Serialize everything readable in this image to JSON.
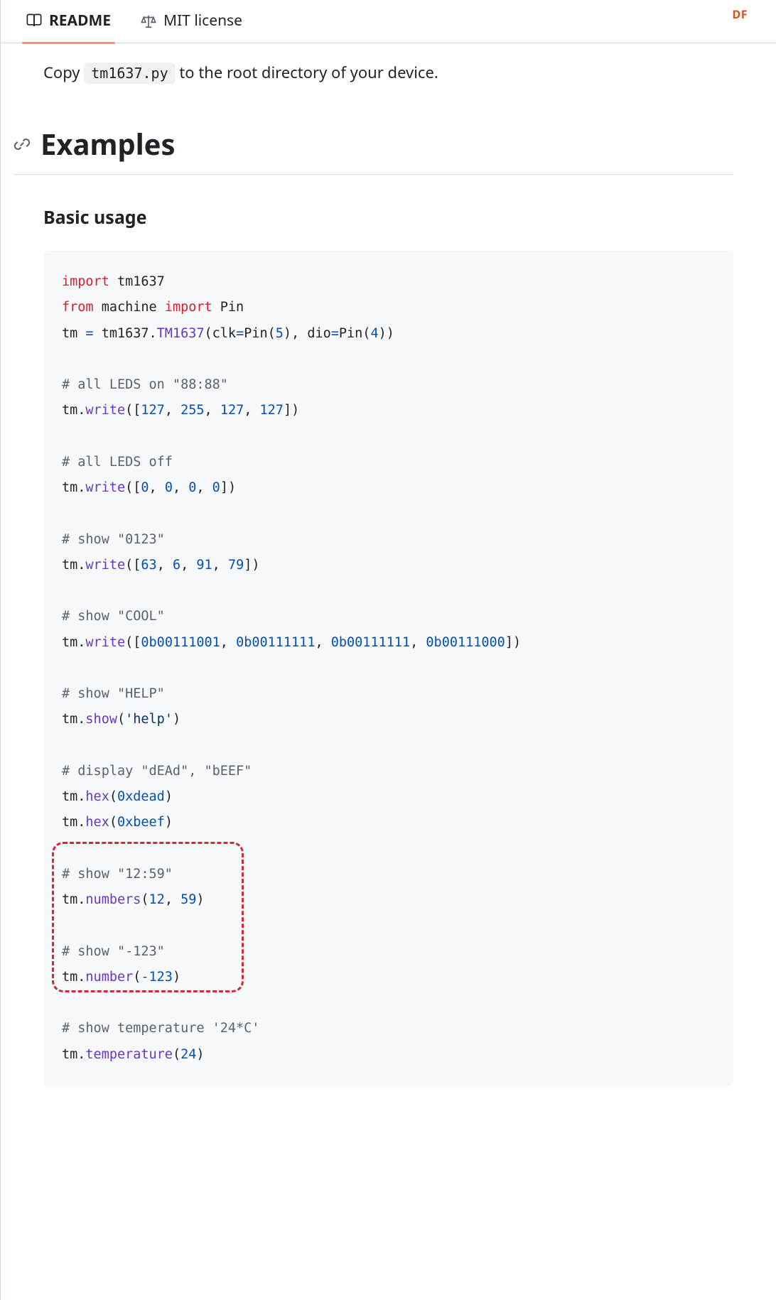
{
  "header": {
    "badge": "DF",
    "tabs": {
      "readme": "README",
      "license": "MIT license"
    }
  },
  "intro": {
    "prefix": "Copy ",
    "code": "tm1637.py",
    "suffix": " to the root directory of your device."
  },
  "headings": {
    "examples": "Examples",
    "basic_usage": "Basic usage"
  },
  "code": {
    "l01_kw1": "import",
    "l01_mod": " tm1637",
    "l02_kw1": "from",
    "l02_mod": " machine ",
    "l02_kw2": "import",
    "l02_cls": " Pin",
    "l03_a": "tm ",
    "l03_eq": "=",
    "l03_b": " tm1637.",
    "l03_cls": "TM1637",
    "l03_c": "(",
    "l03_d": "clk",
    "l03_eq2": "=",
    "l03_e": "Pin(",
    "l03_n1": "5",
    "l03_f": "), ",
    "l03_g": "dio",
    "l03_eq3": "=",
    "l03_h": "Pin(",
    "l03_n2": "4",
    "l03_i": "))",
    "c1": "# all LEDS on \"88:88\"",
    "w1_a": "tm.",
    "w1_fn": "write",
    "w1_b": "([",
    "w1_n1": "127",
    "w1_c": ", ",
    "w1_n2": "255",
    "w1_d": ", ",
    "w1_n3": "127",
    "w1_e": ", ",
    "w1_n4": "127",
    "w1_f": "])",
    "c2": "# all LEDS off",
    "w2_a": "tm.",
    "w2_fn": "write",
    "w2_b": "([",
    "w2_n1": "0",
    "w2_c": ", ",
    "w2_n2": "0",
    "w2_d": ", ",
    "w2_n3": "0",
    "w2_e": ", ",
    "w2_n4": "0",
    "w2_f": "])",
    "c3": "# show \"0123\"",
    "w3_a": "tm.",
    "w3_fn": "write",
    "w3_b": "([",
    "w3_n1": "63",
    "w3_c": ", ",
    "w3_n2": "6",
    "w3_d": ", ",
    "w3_n3": "91",
    "w3_e": ", ",
    "w3_n4": "79",
    "w3_f": "])",
    "c4": "# show \"COOL\"",
    "w4_a": "tm.",
    "w4_fn": "write",
    "w4_b": "([",
    "w4_n1": "0b00111001",
    "w4_c": ", ",
    "w4_n2": "0b00111111",
    "w4_d": ", ",
    "w4_n3": "0b00111111",
    "w4_e": ", ",
    "w4_n4": "0b00111000",
    "w4_f": "])",
    "c5": "# show \"HELP\"",
    "s1_a": "tm.",
    "s1_fn": "show",
    "s1_b": "(",
    "s1_str": "'help'",
    "s1_c": ")",
    "c6": "# display \"dEAd\", \"bEEF\"",
    "h1_a": "tm.",
    "h1_fn": "hex",
    "h1_b": "(",
    "h1_n": "0xdead",
    "h1_c": ")",
    "h2_a": "tm.",
    "h2_fn": "hex",
    "h2_b": "(",
    "h2_n": "0xbeef",
    "h2_c": ")",
    "c7": "# show \"12:59\"",
    "n1_a": "tm.",
    "n1_fn": "numbers",
    "n1_b": "(",
    "n1_n1": "12",
    "n1_c": ", ",
    "n1_n2": "59",
    "n1_d": ")",
    "c8": "# show \"-123\"",
    "n2_a": "tm.",
    "n2_fn": "number",
    "n2_b": "(",
    "n2_op": "-",
    "n2_n": "123",
    "n2_c": ")",
    "c9": "# show temperature '24*C'",
    "t1_a": "tm.",
    "t1_fn": "temperature",
    "t1_b": "(",
    "t1_n": "24",
    "t1_c": ")"
  },
  "annotation": {
    "highlight_lines": "L22-L26"
  }
}
